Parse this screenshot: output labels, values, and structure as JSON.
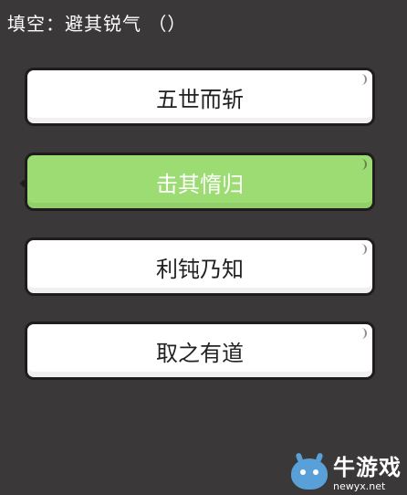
{
  "question": {
    "text": "填空：避其锐气 （）"
  },
  "options": [
    {
      "label": "五世而斩"
    },
    {
      "label": "击其惰归"
    },
    {
      "label": "利钝乃知"
    },
    {
      "label": "取之有道"
    }
  ],
  "selected_index": 1,
  "colors": {
    "background": "#3a3838",
    "option_white": "#ffffff",
    "option_selected": "#9cdc72",
    "border": "#1e1c1c"
  },
  "watermark": {
    "name": "牛游戏",
    "url": "newyx.net",
    "icon": "bull-mascot-icon"
  }
}
